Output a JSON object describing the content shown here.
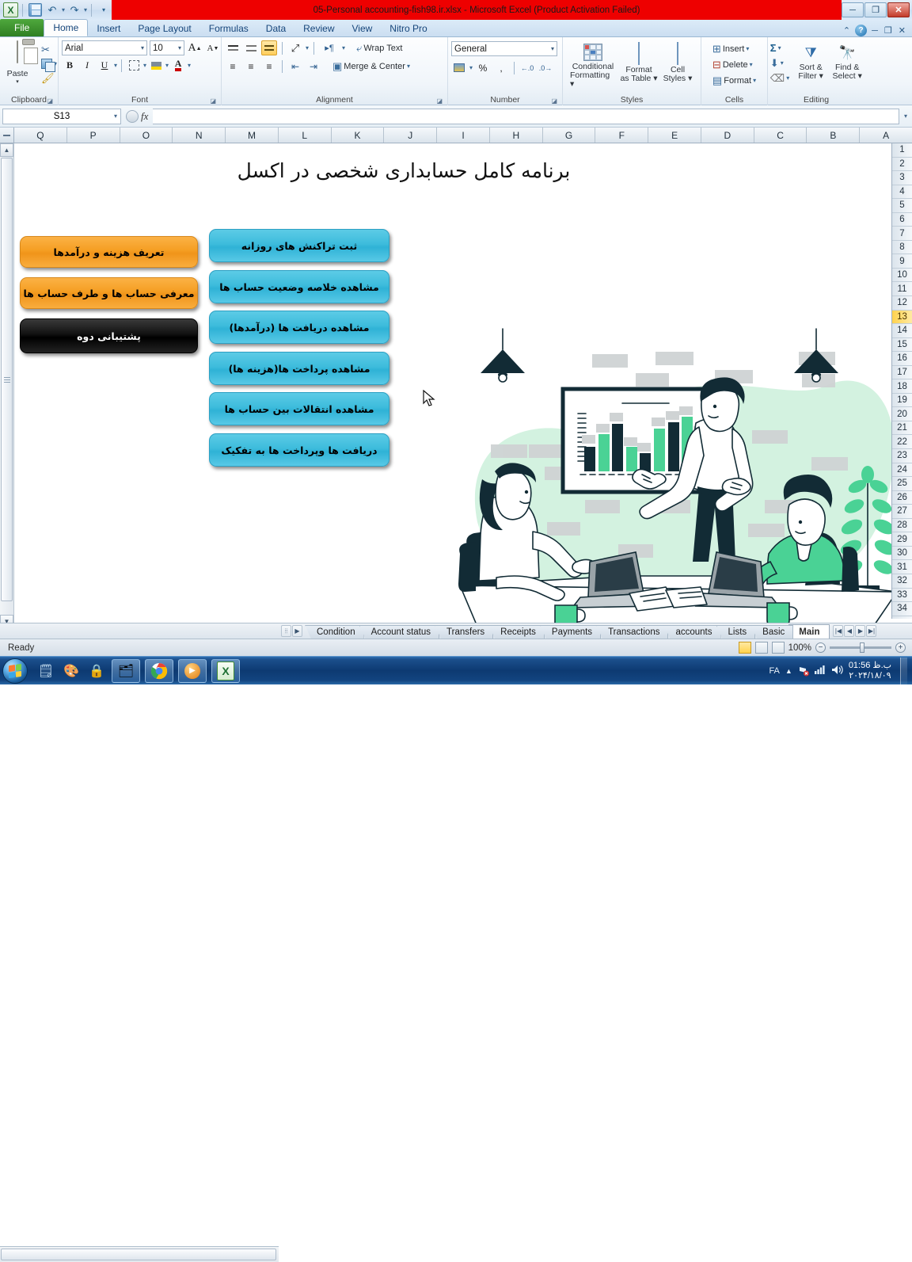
{
  "window": {
    "title": "05-Personal accounting-fish98.ir.xlsx  -  Microsoft Excel (Product Activation Failed)",
    "titlebar_color": "#ee0000",
    "quick_access": [
      {
        "name": "excel-logo",
        "label": "X"
      },
      {
        "name": "save",
        "label": ""
      },
      {
        "name": "undo",
        "label": "↶"
      },
      {
        "name": "redo",
        "label": "↷"
      },
      {
        "name": "customize-qat",
        "label": "▼"
      }
    ],
    "controls": {
      "minimize": "─",
      "restore": "❐",
      "close": "✕"
    },
    "ribbon_controls": {
      "collapse": "⌃",
      "help": "?",
      "minimize": "─",
      "restore": "❐",
      "close": "✕"
    }
  },
  "ribbon": {
    "tabs": [
      {
        "label": "File",
        "active": false,
        "kind": "file"
      },
      {
        "label": "Home",
        "active": true,
        "kind": "normal"
      },
      {
        "label": "Insert",
        "active": false,
        "kind": "normal"
      },
      {
        "label": "Page Layout",
        "active": false,
        "kind": "normal"
      },
      {
        "label": "Formulas",
        "active": false,
        "kind": "normal"
      },
      {
        "label": "Data",
        "active": false,
        "kind": "normal"
      },
      {
        "label": "Review",
        "active": false,
        "kind": "normal"
      },
      {
        "label": "View",
        "active": false,
        "kind": "normal"
      },
      {
        "label": "Nitro Pro",
        "active": false,
        "kind": "normal"
      }
    ],
    "groups": {
      "clipboard": {
        "name": "Clipboard",
        "paste_label": "Paste",
        "cut_label": "",
        "copy_label": "",
        "format_painter_label": ""
      },
      "font": {
        "name": "Font",
        "font_family": "Arial",
        "font_size": "10",
        "grow_label": "A",
        "shrink_label": "A",
        "bold_label": "B",
        "italic_label": "I",
        "underline_label": "U",
        "border_label": "",
        "fill_label": "",
        "fontcolor_label": "A"
      },
      "alignment": {
        "name": "Alignment",
        "wrap_text_label": "Wrap Text",
        "merge_center_label": "Merge & Center"
      },
      "number": {
        "name": "Number",
        "format_value": "General",
        "percent_label": "%",
        "comma_label": ",",
        "inc_dec_label": ".00",
        "dec_dec_label": ".00"
      },
      "styles": {
        "name": "Styles",
        "conditional_formatting_label": "Conditional\nFormatting",
        "cf_line1": "Conditional",
        "cf_line2": "Formatting",
        "format_table_line1": "Format",
        "format_table_line2": "as Table",
        "cell_styles_line1": "Cell",
        "cell_styles_line2": "Styles"
      },
      "cells": {
        "name": "Cells",
        "insert_label": "Insert",
        "delete_label": "Delete",
        "format_label": "Format"
      },
      "editing": {
        "name": "Editing",
        "autosum_label": "Σ",
        "fill_label": "",
        "clear_label": "",
        "sort_filter_line1": "Sort &",
        "sort_filter_line2": "Filter",
        "find_select_line1": "Find &",
        "find_select_line2": "Select"
      }
    }
  },
  "formula_bar": {
    "name_box": "S13",
    "formula_value": "",
    "fx_label": "fx"
  },
  "grid": {
    "columns": [
      "Q",
      "P",
      "O",
      "N",
      "M",
      "L",
      "K",
      "J",
      "I",
      "H",
      "G",
      "F",
      "E",
      "D",
      "C",
      "B",
      "A"
    ],
    "rows": [
      "1",
      "2",
      "3",
      "4",
      "5",
      "6",
      "7",
      "8",
      "9",
      "10",
      "11",
      "12",
      "13",
      "14",
      "15",
      "16",
      "17",
      "18",
      "19",
      "20",
      "21",
      "22",
      "23",
      "24",
      "25",
      "26",
      "27",
      "28",
      "29",
      "30",
      "31",
      "32",
      "33",
      "34"
    ],
    "selected_row": "13",
    "selected_cell": "S13"
  },
  "sheet": {
    "title": "برنامه کامل حسابداری شخصی در اکسل",
    "left_buttons": [
      {
        "label": "تعریف هزینه و درآمدها",
        "color": "#f59e22",
        "style": "orange"
      },
      {
        "label": "معرفی حساب ها و طرف حساب ها",
        "color": "#f59e22",
        "style": "orange"
      },
      {
        "label": "پشتیبانی دوه",
        "color": "#000000",
        "style": "black"
      }
    ],
    "main_buttons": [
      {
        "label": "ثبت تراکنش های روزانه",
        "color": "#3dbcdc"
      },
      {
        "label": "مشاهده خلاصه وضعیت حساب ها",
        "color": "#3dbcdc"
      },
      {
        "label": "مشاهده دریافت ها (درآمدها)",
        "color": "#3dbcdc"
      },
      {
        "label": "مشاهده پرداخت ها(هزینه ها)",
        "color": "#3dbcdc"
      },
      {
        "label": "مشاهده انتقالات بین حساب ها",
        "color": "#3dbcdc"
      },
      {
        "label": "دریافت ها وپرداخت ها به تفکیک",
        "color": "#3dbcdc"
      }
    ],
    "illustration": {
      "name": "business-meeting-illustration",
      "blob_color": "#d3f2e0",
      "accent_color": "#4ad295",
      "ink_color": "#122b35"
    }
  },
  "sheet_tabs": {
    "tabs": [
      {
        "label": "Condition",
        "active": false
      },
      {
        "label": "Account status",
        "active": false
      },
      {
        "label": "Transfers",
        "active": false
      },
      {
        "label": "Receipts",
        "active": false
      },
      {
        "label": "Payments",
        "active": false
      },
      {
        "label": "Transactions",
        "active": false
      },
      {
        "label": "accounts",
        "active": false
      },
      {
        "label": "Lists",
        "active": false
      },
      {
        "label": "Basic",
        "active": false
      },
      {
        "label": "Main",
        "active": true
      }
    ],
    "nav": {
      "first": "⏮",
      "prev": "◀",
      "next": "▶",
      "last": "⏭"
    }
  },
  "status_bar": {
    "state": "Ready",
    "zoom": "100%",
    "views": [
      "normal-view",
      "page-layout-view",
      "page-break-view"
    ]
  },
  "taskbar": {
    "start_label": "",
    "apps": [
      {
        "name": "notepad",
        "glyph": "🗒",
        "pinned": false
      },
      {
        "name": "paint-apps",
        "glyph": "🎨",
        "pinned": false
      },
      {
        "name": "security-lock",
        "glyph": "🔒",
        "pinned": false
      },
      {
        "name": "file-explorer",
        "glyph": "🗂",
        "pinned": true
      },
      {
        "name": "google-chrome",
        "glyph": "",
        "pinned": true
      },
      {
        "name": "media-player",
        "glyph": "▶",
        "pinned": true
      },
      {
        "name": "microsoft-excel",
        "glyph": "X",
        "pinned": true
      }
    ],
    "tray": {
      "language": "FA",
      "show_hidden": "▲",
      "network": "",
      "signal": "",
      "volume": "🔊",
      "time": "01:56 ب.ظ",
      "date": "۲۰۲۴/۱۸/۰۹"
    }
  }
}
